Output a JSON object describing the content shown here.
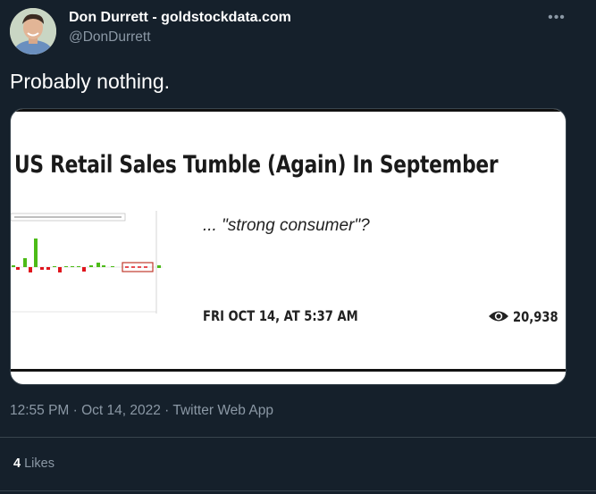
{
  "author": {
    "display_name": "Don Durrett - goldstockdata.com",
    "handle": "@DonDurrett",
    "avatar_icon": "profile-photo"
  },
  "tweet": {
    "text": "Probably nothing.",
    "more_icon": "more-horizontal-icon",
    "timestamp": "12:55 PM · Oct 14, 2022 · Twitter Web App"
  },
  "card": {
    "headline": "US Retail Sales Tumble (Again) In September",
    "subtitle": "... \"strong consumer\"?",
    "date": "FRI OCT 14, AT 5:37 AM",
    "views_icon": "eye-icon",
    "views": "20,938"
  },
  "stats": {
    "likes_count": "4",
    "likes_label": " Likes"
  },
  "colors": {
    "background": "#15202b",
    "secondary_text": "#8b98a5",
    "bar_positive": "#4cbb17",
    "bar_negative": "#e0151c"
  }
}
